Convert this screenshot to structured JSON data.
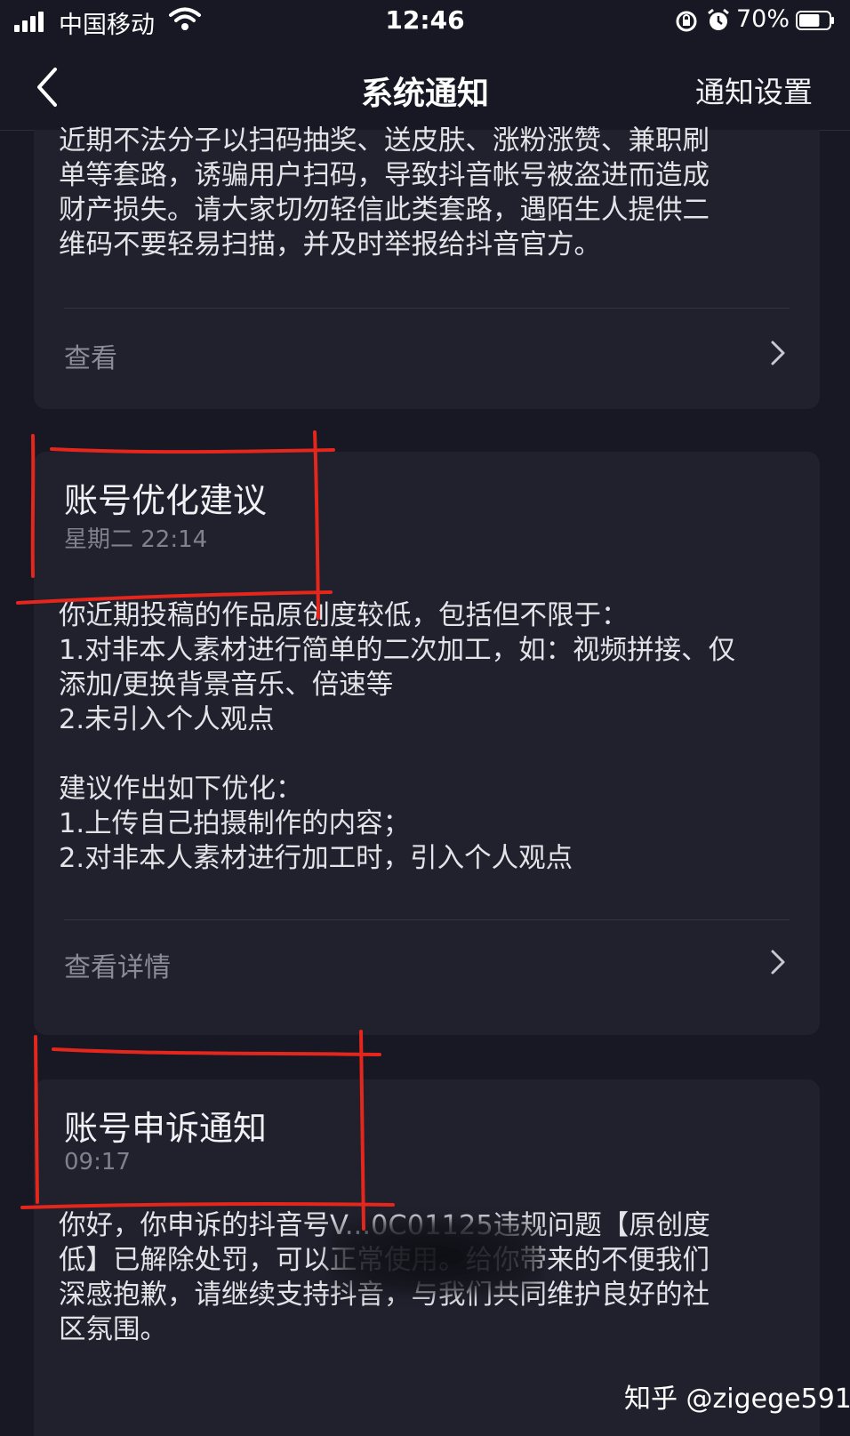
{
  "status_bar": {
    "carrier": "中国移动",
    "time": "12:46",
    "battery_percent": "70%",
    "battery_level": 0.7
  },
  "nav": {
    "title": "系统通知",
    "settings_label": "通知设置"
  },
  "cards": [
    {
      "body": "近期不法分子以扫码抽奖、送皮肤、涨粉涨赞、兼职刷\n单等套路，诱骗用户扫码，导致抖音帐号被盗进而造成\n财产损失。请大家切勿轻信此类套路，遇陌生人提供二\n维码不要轻易扫描，并及时举报给抖音官方。",
      "link_label": "查看"
    },
    {
      "title": "账号优化建议",
      "time": "星期二 22:14",
      "body": "你近期投稿的作品原创度较低，包括但不限于：\n1.对非本人素材进行简单的二次加工，如：视频拼接、仅\n添加/更换背景音乐、倍速等\n2.未引入个人观点\n\n建议作出如下优化：\n1.上传自己拍摄制作的内容；\n2.对非本人素材进行加工时，引入个人观点",
      "link_label": "查看详情"
    },
    {
      "title": "账号申诉通知",
      "time": "09:17",
      "body": "你好，你申诉的抖音号V...0C01125违规问题【原创度\n低】已解除处罚，可以正常使用。给你带来的不便我们\n深感抱歉，请继续支持抖音，与我们共同维护良好的社\n区氛围。"
    }
  ],
  "watermark": "知乎 @zigege591",
  "colors": {
    "background": "#171823",
    "card": "#20212d",
    "annotation": "#e4261c"
  }
}
